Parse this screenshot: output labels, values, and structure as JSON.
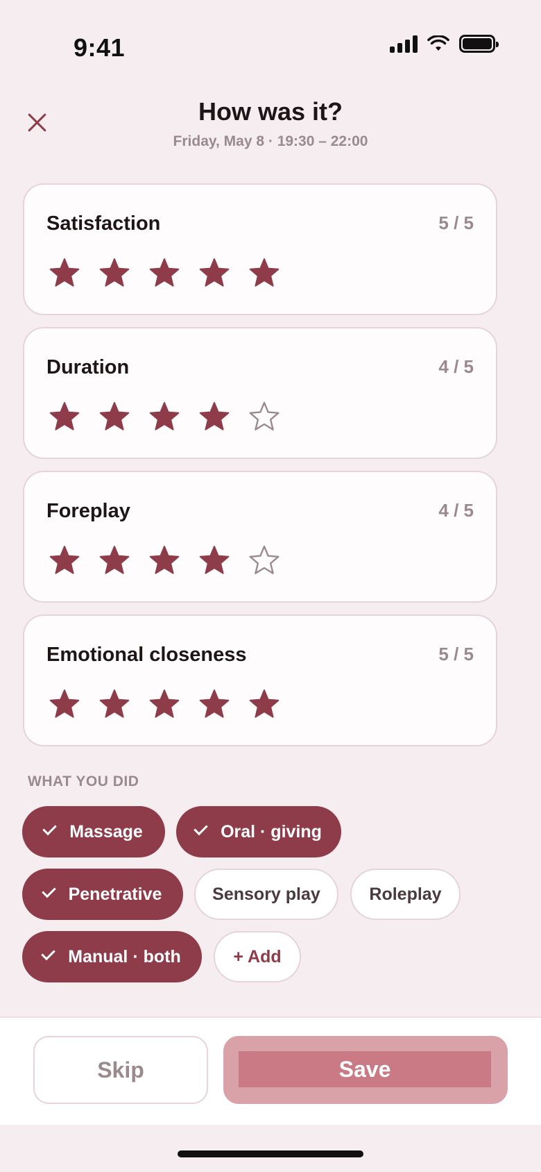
{
  "status_bar": {
    "time": "9:41"
  },
  "header": {
    "title": "How was it?",
    "subtitle": "Friday, May 8 · 19:30 – 22:00"
  },
  "ratings": [
    {
      "label": "Satisfaction",
      "score": "5 / 5",
      "value": 5,
      "max": 5
    },
    {
      "label": "Duration",
      "score": "4 / 5",
      "value": 4,
      "max": 5
    },
    {
      "label": "Foreplay",
      "score": "4 / 5",
      "value": 4,
      "max": 5
    },
    {
      "label": "Emotional closeness",
      "score": "5 / 5",
      "value": 5,
      "max": 5
    }
  ],
  "activities": {
    "section_label": "WHAT YOU DID",
    "chips": [
      {
        "label": "Massage",
        "selected": true
      },
      {
        "label": "Oral · giving",
        "selected": true
      },
      {
        "label": "Penetrative",
        "selected": true
      },
      {
        "label": "Sensory play",
        "selected": false
      },
      {
        "label": "Roleplay",
        "selected": false
      },
      {
        "label": "Manual · both",
        "selected": true
      }
    ],
    "add_label": "+ Add"
  },
  "footer": {
    "skip_label": "Skip",
    "save_label": "Save"
  },
  "colors": {
    "accent": "#8e3b4a",
    "background": "#f5edf0",
    "muted_text": "#9a8a8e",
    "save_disabled": "#d9a1a8"
  }
}
